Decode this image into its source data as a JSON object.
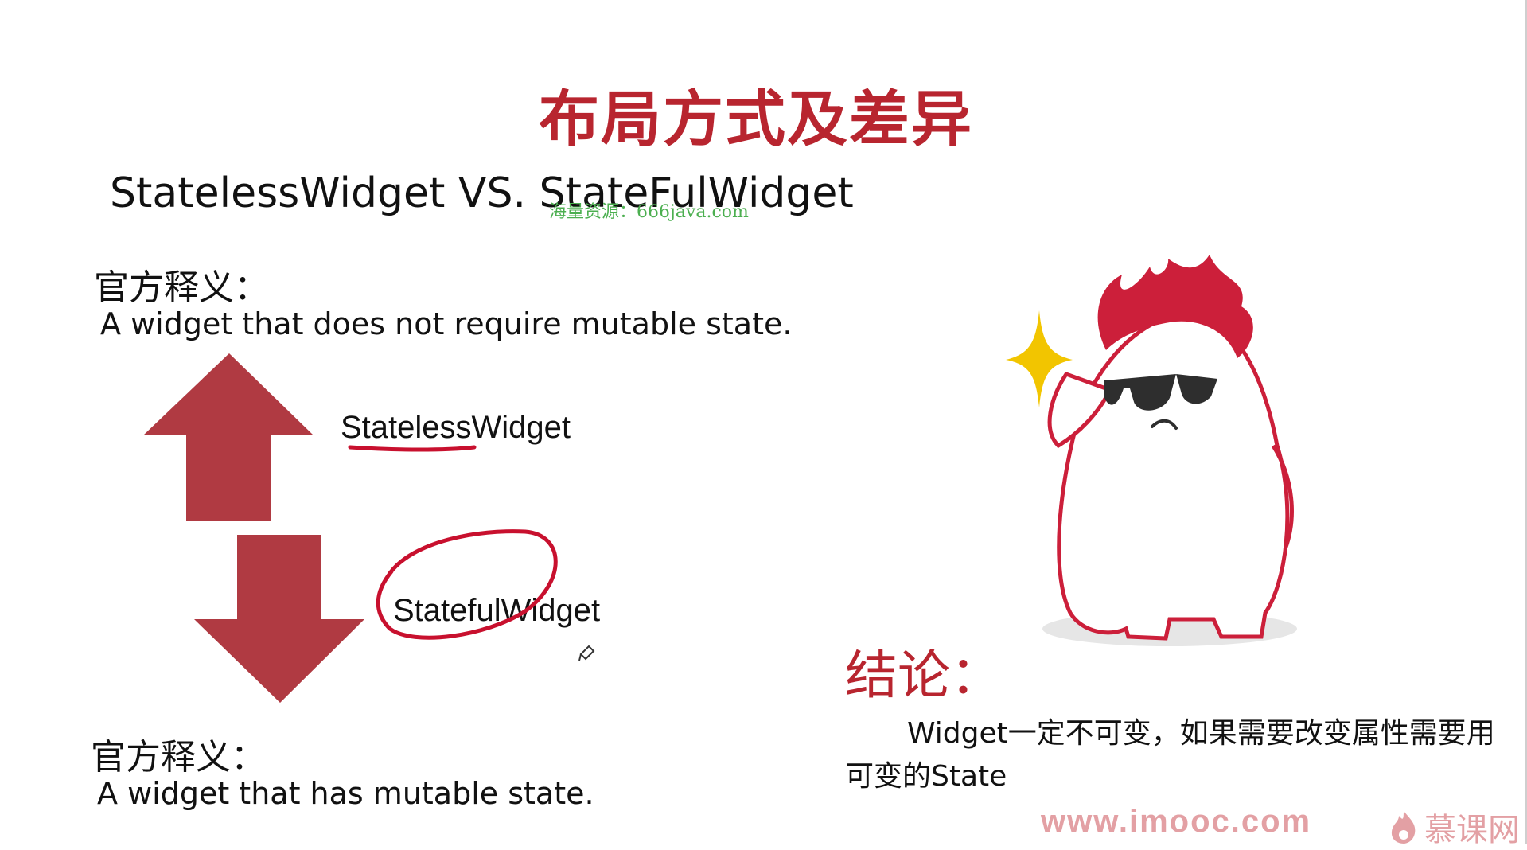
{
  "slide": {
    "title": "布局方式及差异",
    "subtitle": "StatelessWidget VS. StateFulWidget",
    "watermark": "海量资源：666java.com"
  },
  "stateless": {
    "definition_label": "官方释义：",
    "definition_text": "A widget that does not require mutable state.",
    "widget_name": "StatelessWidget"
  },
  "stateful": {
    "definition_label": "官方释义：",
    "definition_text": "A widget that has mutable state.",
    "widget_name": "StatefulWidget"
  },
  "conclusion": {
    "title": "结论：",
    "text": "Widget一定不可变，如果需要改变属性需要用可变的State"
  },
  "footer": {
    "url": "www.imooc.com",
    "brand": "慕课网"
  },
  "colors": {
    "title_red": "#b8252f",
    "arrow_red": "#b03a42",
    "annotation_red": "#c8102e",
    "mascot_red": "#cc1f3a",
    "sparkle_yellow": "#f2c500"
  },
  "icons": {
    "up_arrow": "up-arrow-icon",
    "down_arrow": "down-arrow-icon",
    "mascot": "mascot-illustration",
    "sparkle": "sparkle-icon",
    "pen_cursor": "pen-cursor-icon",
    "brand_logo": "flame-logo-icon"
  }
}
